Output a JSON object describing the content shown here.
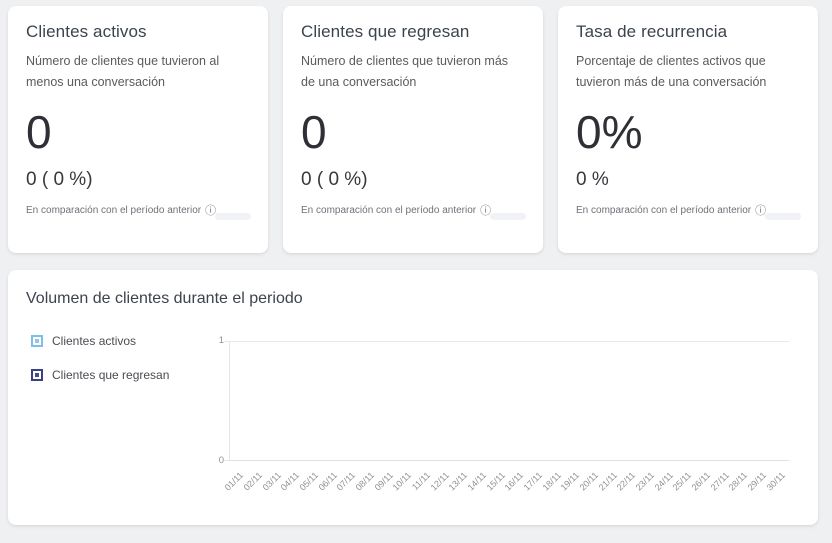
{
  "icons": {
    "info": "ⓘ"
  },
  "colors": {
    "page_background": "#eff0f2",
    "card_background": "#ffffff",
    "heading_text": "#3c434d",
    "series_active": "#7CBFEA",
    "series_returning": "#3A4183",
    "axis_line": "#e5e6e8",
    "tick_text": "#8d9094"
  },
  "stat_cards": [
    {
      "title": "Clientes activos",
      "description": "Número de clientes que tuvieron al menos una conversación",
      "value": "0",
      "delta": "0 ( 0 %)",
      "note": "En comparación con el período anterior"
    },
    {
      "title": "Clientes que regresan",
      "description": "Número de clientes que tuvieron más de una conversación",
      "value": "0",
      "delta": "0 ( 0 %)",
      "note": "En comparación con el período anterior"
    },
    {
      "title": "Tasa de recurrencia",
      "description": "Porcentaje de clientes activos que tuvieron más de una conversación",
      "value": "0%",
      "delta": "0 %",
      "note": "En comparación con el período anterior"
    }
  ],
  "chart_card": {
    "title": "Volumen de clientes durante el periodo"
  },
  "chart_data": {
    "type": "bar",
    "title": "Volumen de clientes durante el periodo",
    "x": [
      "01/11",
      "02/11",
      "03/11",
      "04/11",
      "05/11",
      "06/11",
      "07/11",
      "08/11",
      "09/11",
      "10/11",
      "11/11",
      "12/11",
      "13/11",
      "14/11",
      "15/11",
      "16/11",
      "17/11",
      "18/11",
      "19/11",
      "20/11",
      "21/11",
      "22/11",
      "23/11",
      "24/11",
      "25/11",
      "26/11",
      "27/11",
      "28/11",
      "29/11",
      "30/11"
    ],
    "series": [
      {
        "name": "Clientes activos",
        "color": "#7CBFEA",
        "values": [
          0,
          0,
          0,
          0,
          0,
          0,
          0,
          0,
          0,
          0,
          0,
          0,
          0,
          0,
          0,
          0,
          0,
          0,
          0,
          0,
          0,
          0,
          0,
          0,
          0,
          0,
          0,
          0,
          0,
          0
        ]
      },
      {
        "name": "Clientes que regresan",
        "color": "#3A4183",
        "values": [
          0,
          0,
          0,
          0,
          0,
          0,
          0,
          0,
          0,
          0,
          0,
          0,
          0,
          0,
          0,
          0,
          0,
          0,
          0,
          0,
          0,
          0,
          0,
          0,
          0,
          0,
          0,
          0,
          0,
          0
        ]
      }
    ],
    "xlabel": "",
    "ylabel": "",
    "ylim": [
      0,
      1
    ],
    "y_ticks": [
      1,
      0
    ],
    "legend_position": "left",
    "grid": false
  }
}
